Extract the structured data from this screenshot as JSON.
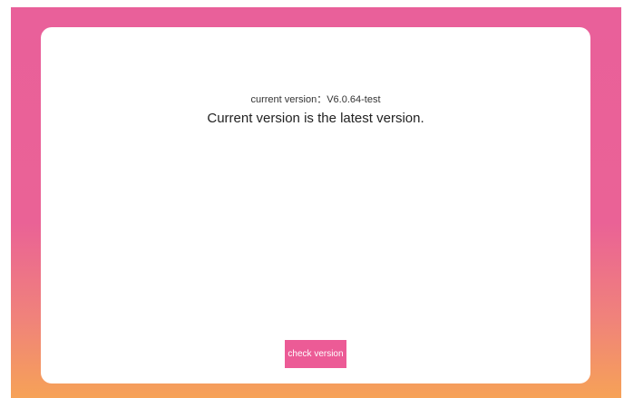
{
  "version_info": {
    "current_version_label": "current version：V6.0.64-test",
    "status_message": "Current version is the latest version."
  },
  "actions": {
    "check_version_label": "check version"
  },
  "colors": {
    "gradient_top": "#e9609a",
    "gradient_bottom": "#f6a257",
    "button_bg": "#ec5b96",
    "card_bg": "#ffffff"
  }
}
